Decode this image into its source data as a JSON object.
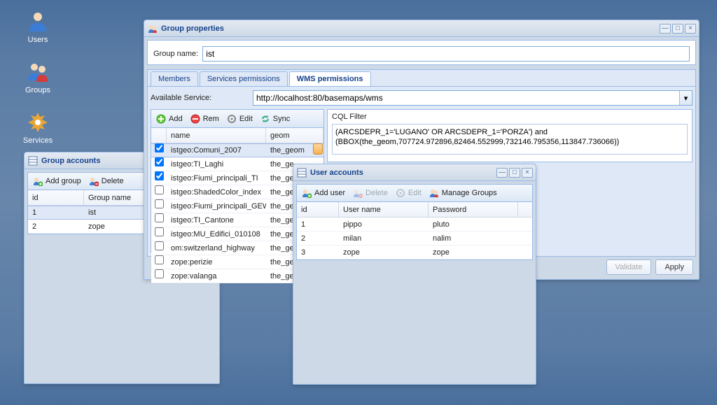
{
  "desktop": {
    "icons": [
      {
        "name": "users-app-icon",
        "label": "Users"
      },
      {
        "name": "groups-app-icon",
        "label": "Groups"
      },
      {
        "name": "services-app-icon",
        "label": "Services"
      }
    ]
  },
  "group_accounts": {
    "title": "Group accounts",
    "toolbar": {
      "add_group": "Add group",
      "delete": "Delete"
    },
    "columns": {
      "id": "id",
      "group_name": "Group name"
    },
    "rows": [
      {
        "id": "1",
        "group_name": "ist"
      },
      {
        "id": "2",
        "group_name": "zope"
      }
    ]
  },
  "group_props": {
    "title": "Group properties",
    "group_name_label": "Group name:",
    "group_name_value": "ist",
    "tabs": {
      "members": "Members",
      "services": "Services permissions",
      "wms": "WMS permissions"
    },
    "available_service_label": "Available Service:",
    "available_service_value": "http://localhost:80/basemaps/wms",
    "layer_toolbar": {
      "add": "Add",
      "rem": "Rem",
      "edit": "Edit",
      "sync": "Sync"
    },
    "layer_columns": {
      "name": "name",
      "geom": "geom"
    },
    "layer_rows": [
      {
        "checked": true,
        "name": "istgeo:Comuni_2007",
        "geom": "the_geom"
      },
      {
        "checked": true,
        "name": "istgeo:TI_Laghi",
        "geom": "the_ge"
      },
      {
        "checked": true,
        "name": "istgeo:Fiumi_principali_TI",
        "geom": "the_ge"
      },
      {
        "checked": false,
        "name": "istgeo:ShadedColor_index",
        "geom": "the_ge"
      },
      {
        "checked": false,
        "name": "istgeo:Fiumi_principali_GEWISS",
        "geom": "the_ge"
      },
      {
        "checked": false,
        "name": "istgeo:TI_Cantone",
        "geom": "the_ge"
      },
      {
        "checked": false,
        "name": "istgeo:MU_Edifici_010108",
        "geom": "the_ge"
      },
      {
        "checked": false,
        "name": "om:switzerland_highway",
        "geom": "the_ge"
      },
      {
        "checked": false,
        "name": "zope:perizie",
        "geom": "the_ge"
      },
      {
        "checked": false,
        "name": "zope:valanga",
        "geom": "the_ge"
      }
    ],
    "cql_label": "CQL Filter",
    "cql_value": "(ARCSDEPR_1='LUGANO' OR ARCSDEPR_1='PORZA') and (BBOX(the_geom,707724.972896,82464.552999,732146.795356,113847.736066))",
    "validate": "Validate",
    "apply": "Apply"
  },
  "user_accounts": {
    "title": "User accounts",
    "toolbar": {
      "add_user": "Add user",
      "delete": "Delete",
      "edit": "Edit",
      "manage_groups": "Manage Groups"
    },
    "columns": {
      "id": "id",
      "user": "User name",
      "pass": "Password"
    },
    "rows": [
      {
        "id": "1",
        "user": "pippo",
        "pass": "pluto"
      },
      {
        "id": "2",
        "user": "milan",
        "pass": "nalim"
      },
      {
        "id": "3",
        "user": "zope",
        "pass": "zope"
      }
    ]
  }
}
